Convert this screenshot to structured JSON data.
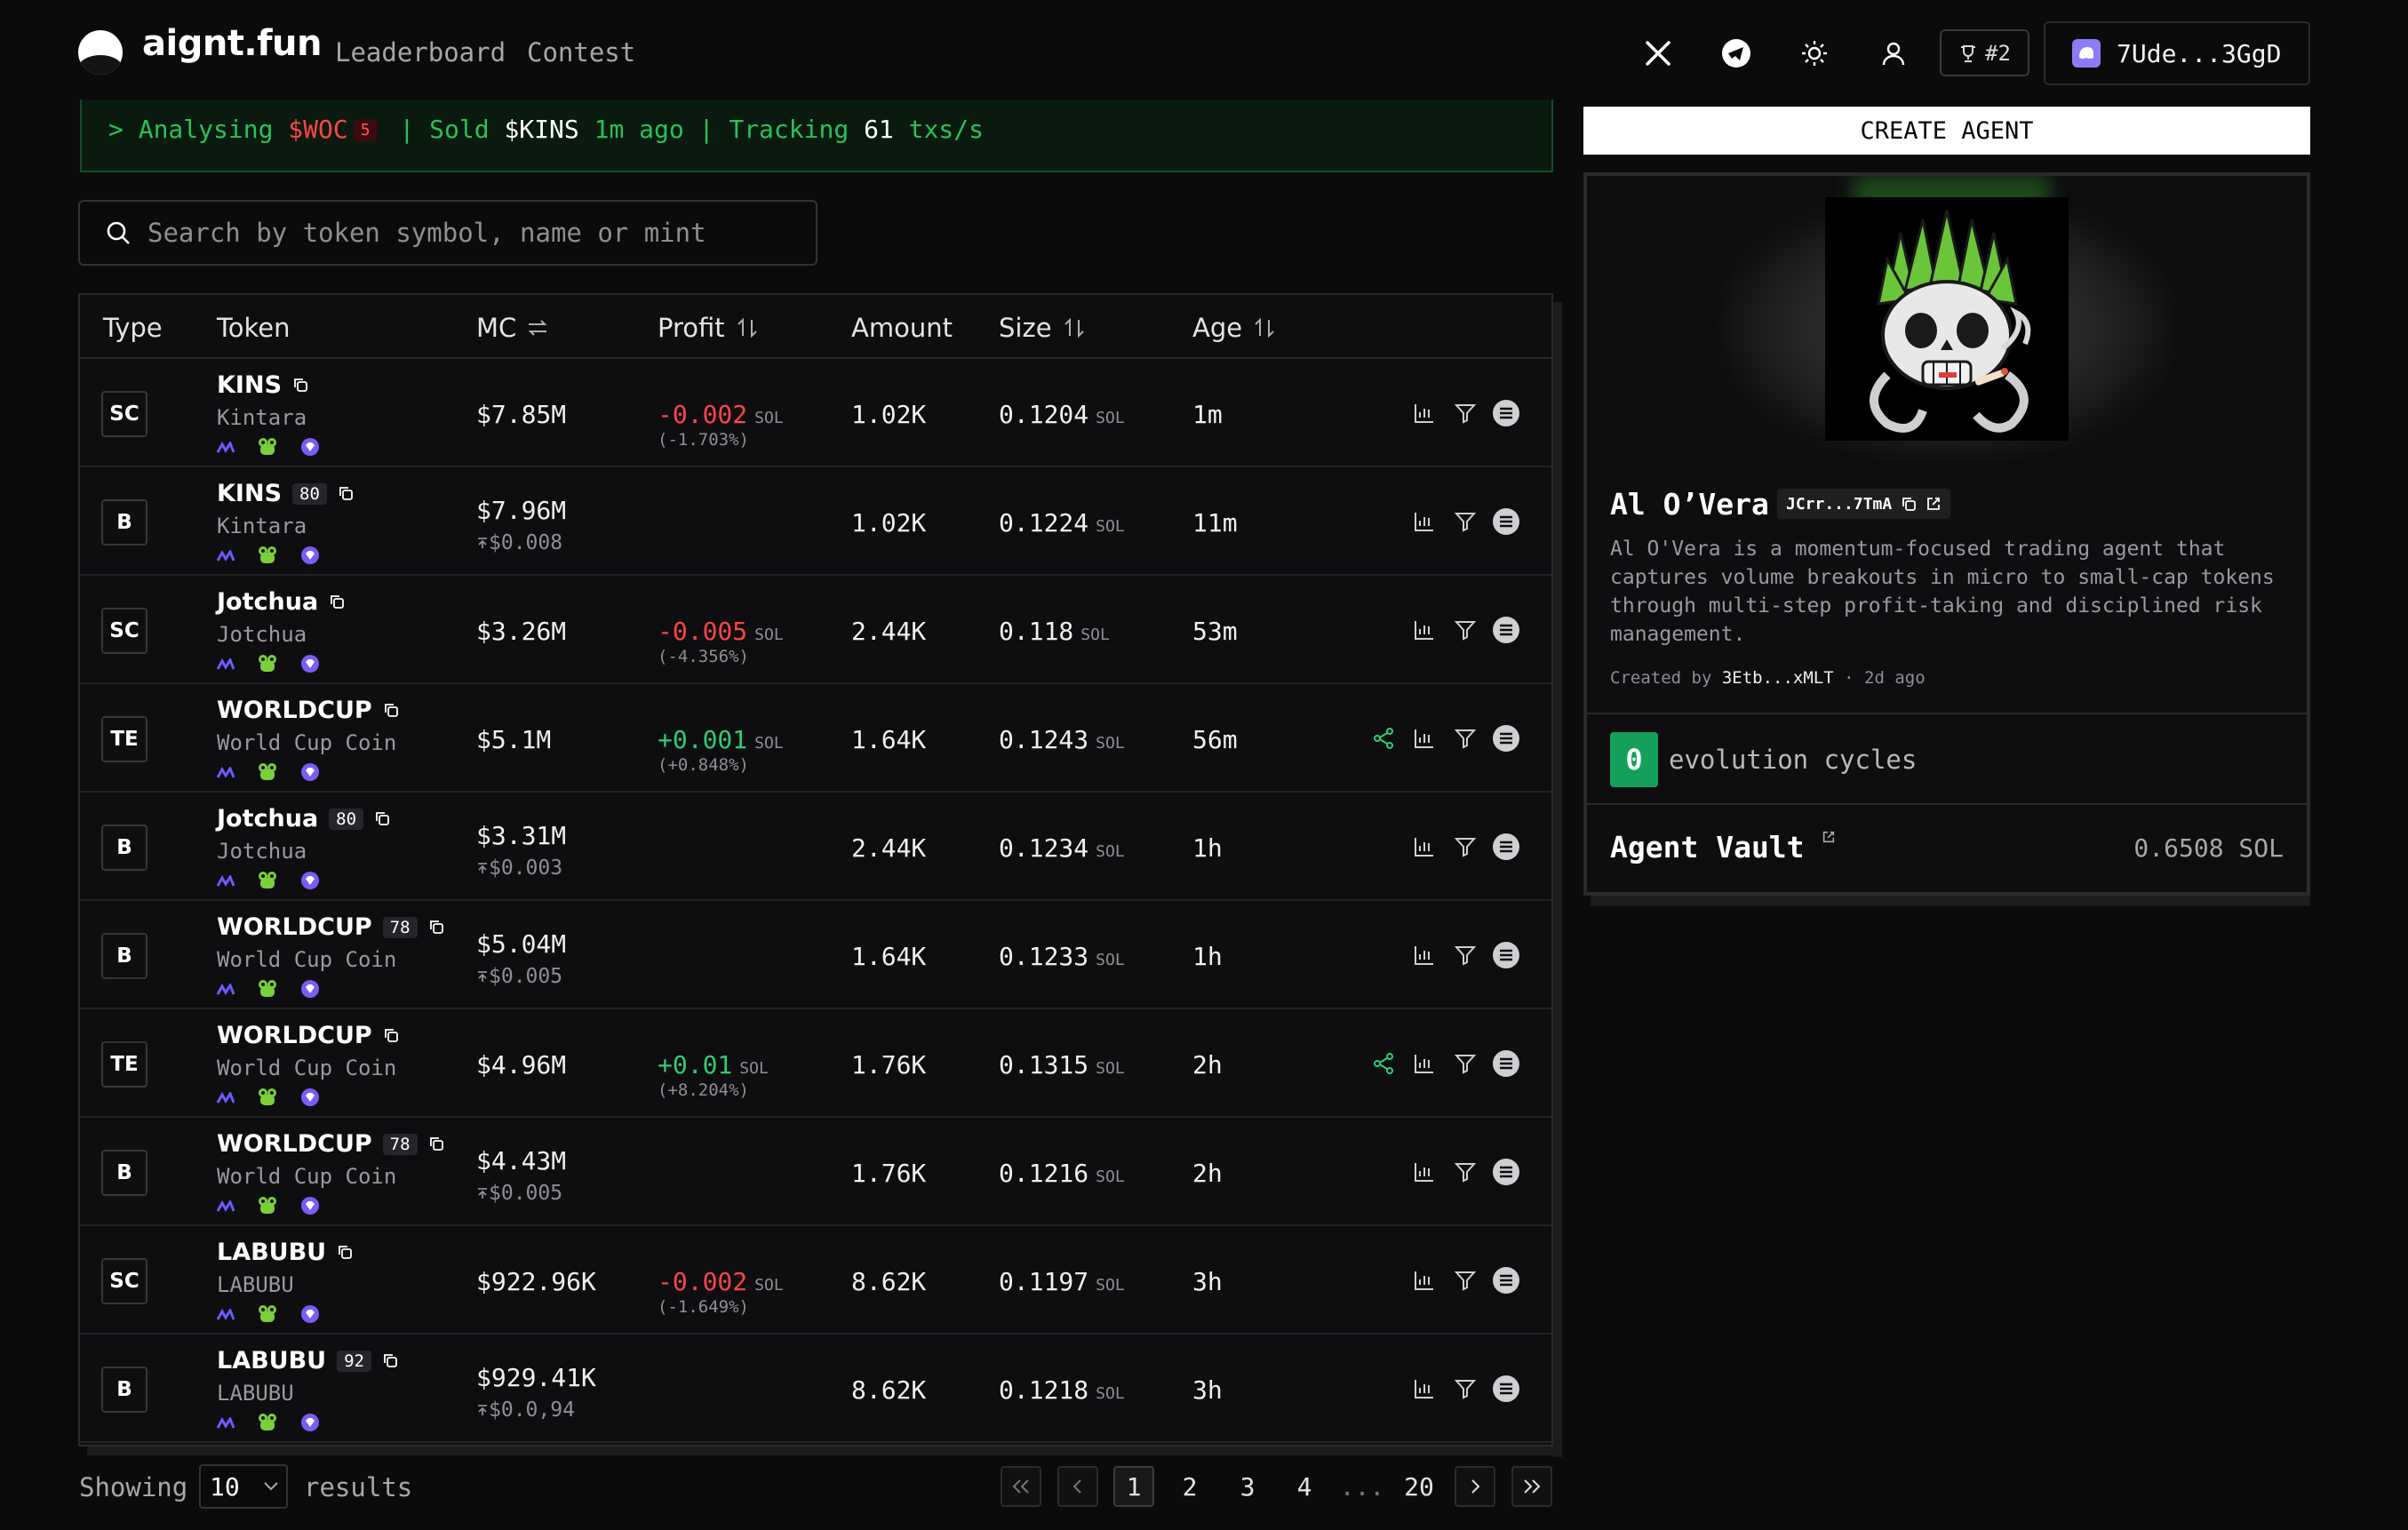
{
  "header": {
    "brand": "aignt.fun",
    "nav": [
      "Leaderboard",
      "Contest"
    ],
    "rank": "#2",
    "wallet": "7Ude...3GgD"
  },
  "ticker": {
    "prefix": "> Analysing",
    "token1": "$WOC",
    "badge": "5",
    "sep1": "| Sold",
    "token2": "$KINS",
    "time": "1m ago",
    "sep2": "| Tracking",
    "rate": "61",
    "rate_unit": "txs/s"
  },
  "search": {
    "placeholder": "Search by token symbol, name or mint"
  },
  "table": {
    "columns": [
      "Type",
      "Token",
      "MC",
      "Profit",
      "Amount",
      "Size",
      "Age"
    ],
    "sol_unit": "SOL",
    "rows": [
      {
        "type": "SC",
        "name": "KINS",
        "num": "",
        "sub": "Kintara",
        "mc": "$7.85M",
        "mc_sub": "",
        "profit": "-0.002",
        "profit_pct": "(-1.703%)",
        "amount": "1.02K",
        "size": "0.1204",
        "age": "1m",
        "share": false
      },
      {
        "type": "B",
        "name": "KINS",
        "num": "80",
        "sub": "Kintara",
        "mc": "$7.96M",
        "mc_sub": "$0.008",
        "profit": "",
        "profit_pct": "",
        "amount": "1.02K",
        "size": "0.1224",
        "age": "11m",
        "share": false
      },
      {
        "type": "SC",
        "name": "Jotchua",
        "num": "",
        "sub": "Jotchua",
        "mc": "$3.26M",
        "mc_sub": "",
        "profit": "-0.005",
        "profit_pct": "(-4.356%)",
        "amount": "2.44K",
        "size": "0.118",
        "age": "53m",
        "share": false
      },
      {
        "type": "TE",
        "name": "WORLDCUP",
        "num": "",
        "sub": "World Cup Coin",
        "mc": "$5.1M",
        "mc_sub": "",
        "profit": "+0.001",
        "profit_pct": "(+0.848%)",
        "amount": "1.64K",
        "size": "0.1243",
        "age": "56m",
        "share": true
      },
      {
        "type": "B",
        "name": "Jotchua",
        "num": "80",
        "sub": "Jotchua",
        "mc": "$3.31M",
        "mc_sub": "$0.003",
        "profit": "",
        "profit_pct": "",
        "amount": "2.44K",
        "size": "0.1234",
        "age": "1h",
        "share": false
      },
      {
        "type": "B",
        "name": "WORLDCUP",
        "num": "78",
        "sub": "World Cup Coin",
        "mc": "$5.04M",
        "mc_sub": "$0.005",
        "profit": "",
        "profit_pct": "",
        "amount": "1.64K",
        "size": "0.1233",
        "age": "1h",
        "share": false
      },
      {
        "type": "TE",
        "name": "WORLDCUP",
        "num": "",
        "sub": "World Cup Coin",
        "mc": "$4.96M",
        "mc_sub": "",
        "profit": "+0.01",
        "profit_pct": "(+8.204%)",
        "amount": "1.76K",
        "size": "0.1315",
        "age": "2h",
        "share": true
      },
      {
        "type": "B",
        "name": "WORLDCUP",
        "num": "78",
        "sub": "World Cup Coin",
        "mc": "$4.43M",
        "mc_sub": "$0.005",
        "profit": "",
        "profit_pct": "",
        "amount": "1.76K",
        "size": "0.1216",
        "age": "2h",
        "share": false
      },
      {
        "type": "SC",
        "name": "LABUBU",
        "num": "",
        "sub": "LABUBU",
        "mc": "$922.96K",
        "mc_sub": "",
        "profit": "-0.002",
        "profit_pct": "(-1.649%)",
        "amount": "8.62K",
        "size": "0.1197",
        "age": "3h",
        "share": false
      },
      {
        "type": "B",
        "name": "LABUBU",
        "num": "92",
        "sub": "LABUBU",
        "mc": "$929.41K",
        "mc_sub": "$0.0,94",
        "profit": "",
        "profit_pct": "",
        "amount": "8.62K",
        "size": "0.1218",
        "age": "3h",
        "share": false
      }
    ]
  },
  "footer": {
    "showing": "Showing",
    "per_page": "10",
    "results": "results",
    "pages": [
      "1",
      "2",
      "3",
      "4",
      "...",
      "20"
    ],
    "current_page": "1"
  },
  "agent": {
    "create_label": "CREATE AGENT",
    "name": "Al O’Vera",
    "address": "JCrr...7TmA",
    "description": "Al O'Vera is a momentum-focused trading agent that captures volume breakouts in micro to small-cap tokens through multi-step profit-taking and disciplined risk management.",
    "created_prefix": "Created by",
    "created_by": "3Etb...xMLT",
    "created_ago": "2d ago",
    "cycles": "0",
    "cycles_label": "evolution cycles",
    "vault_label": "Agent Vault",
    "vault_value": "0.6508 SOL"
  },
  "colors": {
    "negative": "#ff4646",
    "positive": "#2ecc71",
    "ticker_green": "#28c15a",
    "cycles_green": "#14a05a",
    "wallet_icon": "#8b7cf6"
  }
}
